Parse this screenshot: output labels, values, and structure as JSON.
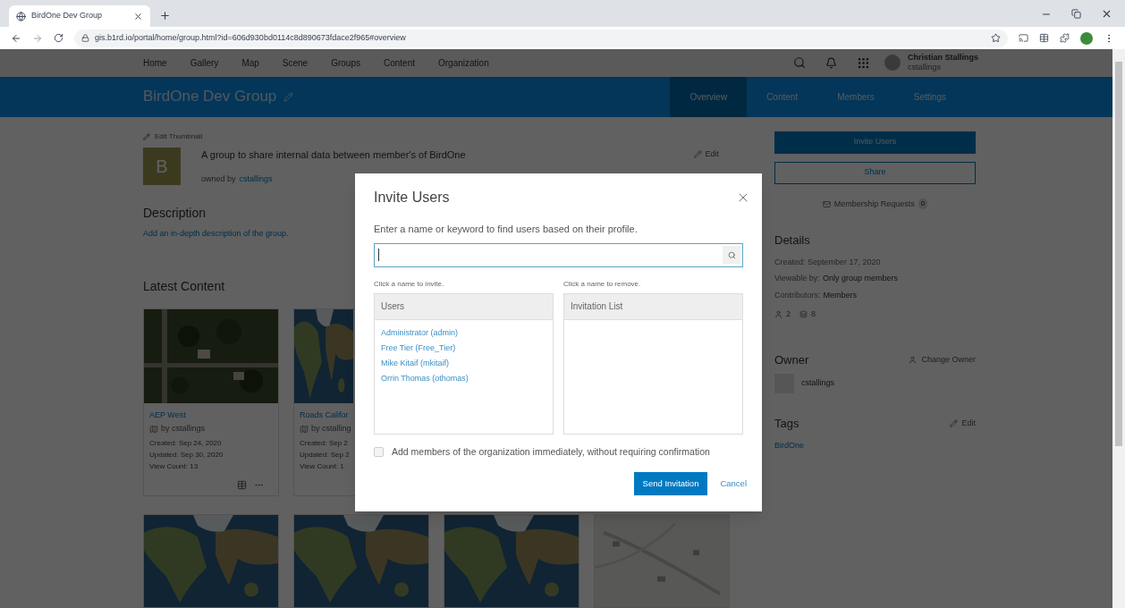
{
  "browser": {
    "tab_title": "BirdOne Dev Group",
    "url": "gis.b1rd.io/portal/home/group.html?id=606d930bd0114c8d890673fdace2f965#overview"
  },
  "nav": {
    "items": [
      "Home",
      "Gallery",
      "Map",
      "Scene",
      "Groups",
      "Content",
      "Organization"
    ],
    "user": {
      "name": "Christian Stallings",
      "username": "cstallings"
    }
  },
  "group_header": {
    "title": "BirdOne Dev Group",
    "tabs": [
      {
        "label": "Overview",
        "selected": true
      },
      {
        "label": "Content",
        "selected": false
      },
      {
        "label": "Members",
        "selected": false
      },
      {
        "label": "Settings",
        "selected": false
      }
    ]
  },
  "overview": {
    "edit_thumbnail": "Edit Thumbnail",
    "thumbnail_letter": "B",
    "summary": "A group to share internal data between member's of BirdOne",
    "owned_by": "owned by",
    "owner_link": "cstallings",
    "edit": "Edit",
    "description_heading": "Description",
    "description_link": "Add an in-depth description of the group.",
    "latest_content_heading": "Latest Content"
  },
  "cards": [
    {
      "title": "AEP West",
      "by": "by cstallings",
      "created": "Created: Sep 24, 2020",
      "updated": "Updated: Sep 30, 2020",
      "views": "View Count: 13"
    },
    {
      "title": "Roads Califor",
      "by": "by cstalling",
      "created": "Created: Sep 2",
      "updated": "Updated: Sep 2",
      "views": "View Count: 1"
    }
  ],
  "sidebar": {
    "invite_button": "Invite Users",
    "share_button": "Share",
    "membership": {
      "label": "Membership Requests",
      "count": "0"
    },
    "details": {
      "heading": "Details",
      "created": "Created: September 17, 2020",
      "viewable_label": "Viewable by:",
      "viewable_value": "Only group members",
      "contributors_label": "Contributors:",
      "contributors_value": "Members",
      "members_count": "2",
      "items_count": "8"
    },
    "owner": {
      "heading": "Owner",
      "change_owner": "Change Owner",
      "username": "cstallings"
    },
    "tags": {
      "heading": "Tags",
      "edit": "Edit",
      "items": [
        "BirdOne"
      ]
    }
  },
  "modal": {
    "title": "Invite Users",
    "prompt": "Enter a name or keyword to find users based on their profile.",
    "invite_hint": "Click a name to invite.",
    "remove_hint": "Click a name to remove.",
    "users_header": "Users",
    "users": [
      "Administrator (admin)",
      "Free Tier (Free_Tier)",
      "Mike Kitaif (mkitaif)",
      "Orrin Thomas (othomas)"
    ],
    "invitation_header": "Invitation List",
    "auto_add": {
      "label": "Add members of the organization immediately, without requiring confirmation",
      "checked": false
    },
    "send_button": "Send Invitation",
    "cancel_link": "Cancel"
  }
}
